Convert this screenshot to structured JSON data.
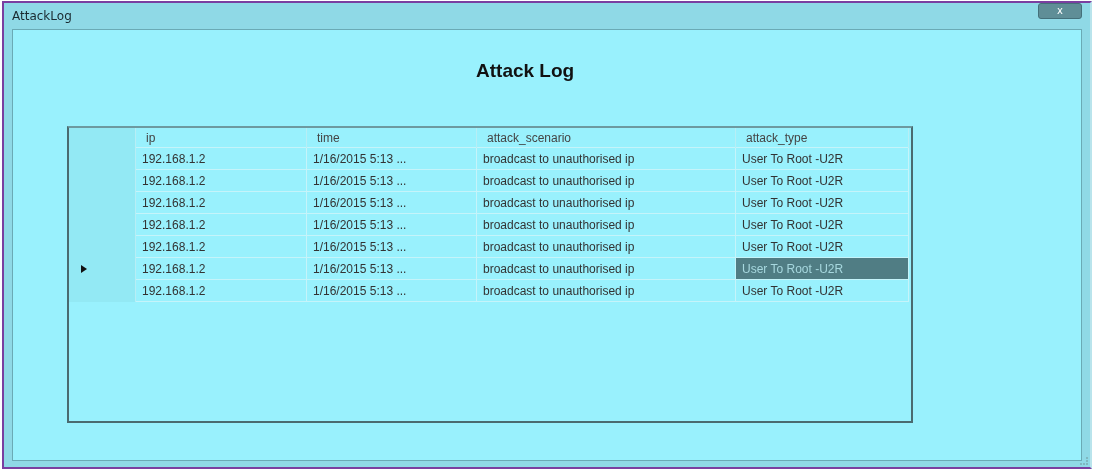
{
  "window": {
    "title": "AttackLog",
    "close_label": "x"
  },
  "heading": "Attack Log",
  "table": {
    "columns": [
      "ip",
      "time",
      "attack_scenario",
      "attack_type"
    ],
    "rows": [
      {
        "current": false,
        "cells": [
          {
            "text": "192.168.1.2",
            "selected": false
          },
          {
            "text": "1/16/2015 5:13 ...",
            "selected": false
          },
          {
            "text": "broadcast to unauthorised ip",
            "selected": false
          },
          {
            "text": "User To Root -U2R",
            "selected": false
          }
        ]
      },
      {
        "current": false,
        "cells": [
          {
            "text": "192.168.1.2",
            "selected": false
          },
          {
            "text": "1/16/2015 5:13 ...",
            "selected": false
          },
          {
            "text": "broadcast to unauthorised ip",
            "selected": false
          },
          {
            "text": "User To Root -U2R",
            "selected": false
          }
        ]
      },
      {
        "current": false,
        "cells": [
          {
            "text": "192.168.1.2",
            "selected": false
          },
          {
            "text": "1/16/2015 5:13 ...",
            "selected": false
          },
          {
            "text": "broadcast to unauthorised ip",
            "selected": false
          },
          {
            "text": "User To Root -U2R",
            "selected": false
          }
        ]
      },
      {
        "current": false,
        "cells": [
          {
            "text": "192.168.1.2",
            "selected": false
          },
          {
            "text": "1/16/2015 5:13 ...",
            "selected": false
          },
          {
            "text": "broadcast to unauthorised ip",
            "selected": false
          },
          {
            "text": "User To Root -U2R",
            "selected": false
          }
        ]
      },
      {
        "current": false,
        "cells": [
          {
            "text": "192.168.1.2",
            "selected": false
          },
          {
            "text": "1/16/2015 5:13 ...",
            "selected": false
          },
          {
            "text": "broadcast to unauthorised ip",
            "selected": false
          },
          {
            "text": "User To Root -U2R",
            "selected": false
          }
        ]
      },
      {
        "current": true,
        "cells": [
          {
            "text": "192.168.1.2",
            "selected": false
          },
          {
            "text": "1/16/2015 5:13 ...",
            "selected": false
          },
          {
            "text": "broadcast to unauthorised ip",
            "selected": false
          },
          {
            "text": "User To Root -U2R",
            "selected": true
          }
        ]
      },
      {
        "current": false,
        "cells": [
          {
            "text": "192.168.1.2",
            "selected": false
          },
          {
            "text": "1/16/2015 5:13 ...",
            "selected": false
          },
          {
            "text": "broadcast to unauthorised ip",
            "selected": false
          },
          {
            "text": "User To Root -U2R",
            "selected": false
          }
        ]
      }
    ]
  }
}
